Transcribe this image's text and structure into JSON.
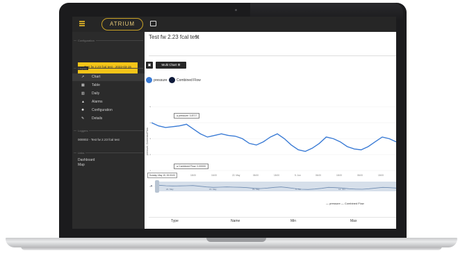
{
  "header": {
    "logo_text": "ATRIUM"
  },
  "sidebar": {
    "configuration_label": "Configuration",
    "test_name": "Test fw 2.23 fcal test - 2022-03-15",
    "display_label": "Display",
    "items": [
      {
        "icon": "line-chart-icon",
        "glyph": "↗",
        "label": "Chart"
      },
      {
        "icon": "table-icon",
        "glyph": "▦",
        "label": "Table"
      },
      {
        "icon": "daily-icon",
        "glyph": "▥",
        "label": "Daily"
      },
      {
        "icon": "alarm-icon",
        "glyph": "▲",
        "label": "Alarms"
      },
      {
        "icon": "gear-icon",
        "glyph": "✹",
        "label": "Configuration"
      },
      {
        "icon": "pencil-icon",
        "glyph": "✎",
        "label": "Details"
      }
    ],
    "loggers_label": "Loggers",
    "logger_item": "000002 - Test fw 2.23 fcal test",
    "links_label": "Links",
    "links": [
      "Dashboard",
      "Map"
    ]
  },
  "main": {
    "title": "Test fw 2.23 fcal test",
    "multi_chart_label": "Multi Chart ⚙",
    "legend": [
      {
        "name": "pressure",
        "color": "#3a7bd5"
      },
      {
        "name": "Combined Flow",
        "color": "#0d1a3a"
      }
    ],
    "tooltip_pressure": "● pressure: 3.8717",
    "tooltip_flow": "● Combined Flow: 0.00000",
    "date_box": "Sunday, May 15, 00:00:00",
    "x_ticks": [
      "18:00",
      "16:00",
      "22. May",
      "06:00",
      "18:00",
      "5. Jun",
      "06:00",
      "18:00",
      "06:00",
      "18:00"
    ],
    "nav_ticks": [
      "22. May",
      "15. May",
      "29. May",
      "5. Jun",
      "12. Jun"
    ],
    "bottom_legend": "— pressure   — Combined Flow",
    "table_headers": [
      "Type",
      "Name",
      "Min",
      "Max"
    ]
  },
  "chart_data": {
    "type": "line",
    "series": [
      {
        "name": "pressure",
        "values": [
          4.0,
          3.8,
          3.7,
          3.75,
          3.8,
          3.9,
          3.6,
          3.3,
          3.1,
          3.2,
          3.3,
          3.2,
          3.15,
          3.0,
          2.7,
          2.6,
          2.8,
          3.1,
          3.3,
          3.0,
          2.6,
          2.3,
          2.2,
          2.4,
          2.7,
          3.1,
          3.0,
          2.8,
          2.5,
          2.35,
          2.3,
          2.5,
          2.8,
          3.1,
          3.0,
          2.8
        ]
      },
      {
        "name": "Combined Flow",
        "values": [
          0,
          0,
          0,
          0,
          0,
          0,
          0,
          0,
          0,
          0,
          0,
          0,
          0,
          0,
          0,
          0,
          0,
          0,
          0,
          0,
          0,
          0,
          0,
          0,
          0,
          0,
          0,
          0,
          0,
          0,
          0,
          0,
          0,
          0,
          0,
          0
        ]
      }
    ],
    "ylabel": "pressure, Combined Flow",
    "ylim": [
      0,
      5
    ]
  }
}
